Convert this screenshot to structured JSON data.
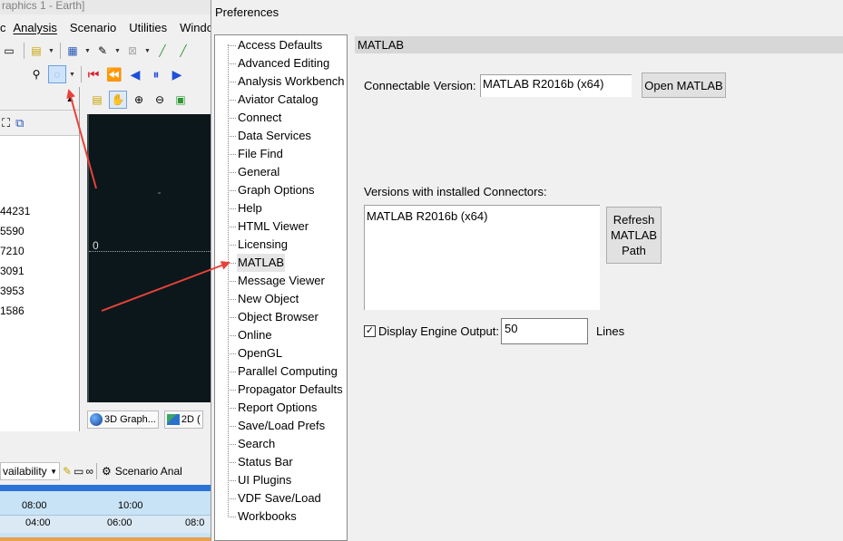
{
  "app": {
    "title_fragment": "raphics 1 - Earth]",
    "menu": [
      "c",
      "Analysis",
      "Scenario",
      "Utilities",
      "Windo"
    ],
    "left_panel_numbers": [
      "44231",
      "5590",
      "7210",
      "3091",
      "3953",
      "1586"
    ],
    "view_label_zero": "0",
    "view_tabs": [
      {
        "label": "3D Graph...",
        "icon": "globe-icon"
      },
      {
        "label": "2D (",
        "icon": "map-2d-icon"
      }
    ],
    "timeline": {
      "combo_label": "vailability",
      "scenario_label": "Scenario Anal",
      "ruler_top": [
        "08:00",
        "10:00"
      ],
      "ruler_bottom": [
        "04:00",
        "06:00",
        "08:0"
      ]
    },
    "colors": {
      "timebar": "#2b73d8",
      "viewport": "#0b171a",
      "arrow": "#e8413a"
    }
  },
  "preferences": {
    "title": "Preferences",
    "tree_items": [
      "Access Defaults",
      "Advanced Editing",
      "Analysis Workbench",
      "Aviator Catalog",
      "Connect",
      "Data Services",
      "File Find",
      "General",
      "Graph Options",
      "Help",
      "HTML Viewer",
      "Licensing",
      "MATLAB",
      "Message Viewer",
      "New Object",
      "Object Browser",
      "Online",
      "OpenGL",
      "Parallel Computing",
      "Propagator Defaults",
      "Report Options",
      "Save/Load Prefs",
      "Search",
      "Status Bar",
      "UI Plugins",
      "VDF Save/Load",
      "Workbooks"
    ],
    "selected_item": "MATLAB",
    "panel": {
      "header": "MATLAB",
      "connectable_label": "Connectable Version:",
      "connectable_value": "MATLAB R2016b (x64)",
      "open_button": "Open MATLAB",
      "installed_label": "Versions with installed Connectors:",
      "installed_versions": [
        "MATLAB R2016b (x64)"
      ],
      "refresh_button_lines": [
        "Refresh",
        "MATLAB",
        "Path"
      ],
      "display_engine_label": "Display Engine Output:",
      "display_engine_checked": true,
      "display_engine_value": "50",
      "lines_label": "Lines"
    }
  }
}
